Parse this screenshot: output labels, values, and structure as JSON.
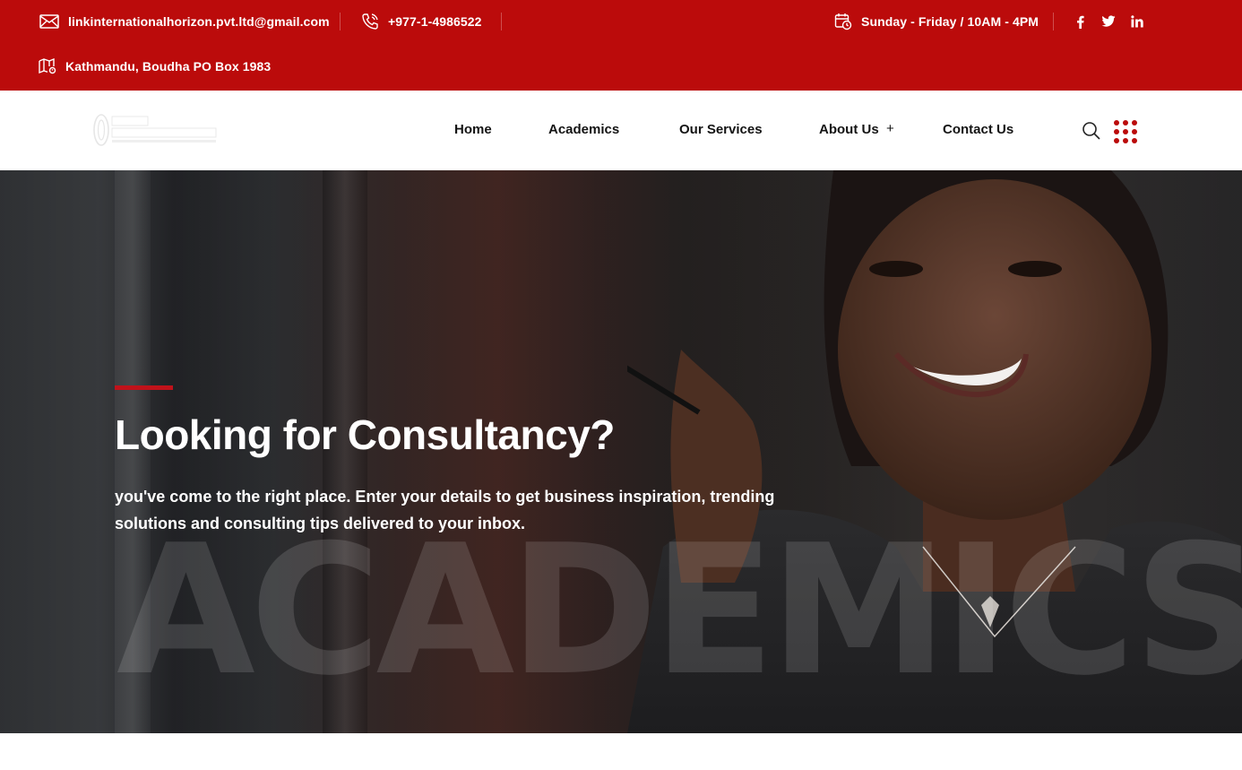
{
  "topbar": {
    "email": "linkinternationalhorizon.pvt.ltd@gmail.com",
    "phone": "+977-1-4986522",
    "hours": "Sunday - Friday / 10AM - 4PM",
    "address": "Kathmandu, Boudha PO Box 1983",
    "social": [
      "facebook-icon",
      "twitter-icon",
      "linkedin-icon"
    ]
  },
  "header": {
    "logo_text": "LINK INTERNATIONAL",
    "nav": {
      "home": "Home",
      "academics": "Academics",
      "services": "Our Services",
      "about": "About Us",
      "about_plus": "+",
      "contact": "Contact Us"
    }
  },
  "hero": {
    "background_word": "ACADEMICS",
    "title": "Looking for Consultancy?",
    "text": "you've come to the right place. Enter your details to get business inspiration, trending solutions and consulting tips delivered to your inbox."
  },
  "colors": {
    "brand_red": "#bb0b0b",
    "accent_red": "#c0121a"
  }
}
